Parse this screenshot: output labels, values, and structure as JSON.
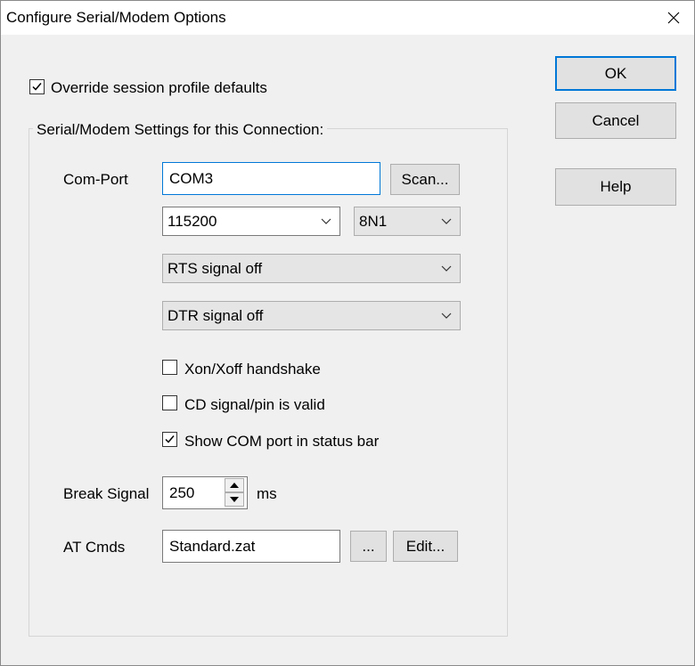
{
  "window": {
    "title": "Configure Serial/Modem Options"
  },
  "override": {
    "label": "Override session profile defaults",
    "checked": true
  },
  "group": {
    "label": "Serial/Modem Settings for this Connection:"
  },
  "com_port": {
    "label": "Com-Port",
    "value": "COM3",
    "scan_label": "Scan..."
  },
  "baud": {
    "selected": "115200"
  },
  "format": {
    "selected": "8N1"
  },
  "rts": {
    "selected": "RTS signal off"
  },
  "dtr": {
    "selected": "DTR signal off"
  },
  "checkboxes": [
    {
      "label": "Xon/Xoff handshake",
      "checked": false
    },
    {
      "label": "CD signal/pin is valid",
      "checked": false
    },
    {
      "label": "Show COM port in status bar",
      "checked": true
    }
  ],
  "break_signal": {
    "label": "Break Signal",
    "value": "250",
    "unit": "ms"
  },
  "at_cmds": {
    "label": "AT Cmds",
    "value": "Standard.zat",
    "browse_label": "...",
    "edit_label": "Edit..."
  },
  "buttons": {
    "ok": "OK",
    "cancel": "Cancel",
    "help": "Help"
  },
  "icons": {
    "close": "close-icon",
    "check": "checkmark-icon",
    "dropdown": "chevron-down-icon",
    "spin_up": "spin-up-icon",
    "spin_down": "spin-down-icon"
  },
  "colors": {
    "accent": "#0078d7",
    "dialog_bg": "#f0f0f0",
    "button_bg": "#e1e1e1"
  }
}
